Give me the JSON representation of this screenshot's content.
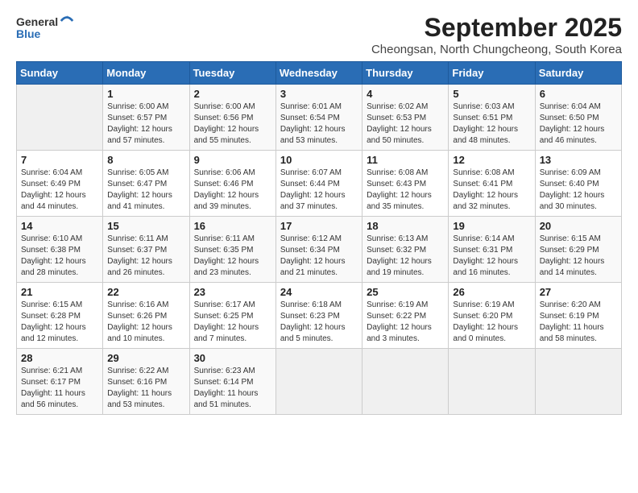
{
  "logo": {
    "general": "General",
    "blue": "Blue"
  },
  "title": "September 2025",
  "subtitle": "Cheongsan, North Chungcheong, South Korea",
  "headers": [
    "Sunday",
    "Monday",
    "Tuesday",
    "Wednesday",
    "Thursday",
    "Friday",
    "Saturday"
  ],
  "weeks": [
    [
      {
        "day": "",
        "info": ""
      },
      {
        "day": "1",
        "info": "Sunrise: 6:00 AM\nSunset: 6:57 PM\nDaylight: 12 hours\nand 57 minutes."
      },
      {
        "day": "2",
        "info": "Sunrise: 6:00 AM\nSunset: 6:56 PM\nDaylight: 12 hours\nand 55 minutes."
      },
      {
        "day": "3",
        "info": "Sunrise: 6:01 AM\nSunset: 6:54 PM\nDaylight: 12 hours\nand 53 minutes."
      },
      {
        "day": "4",
        "info": "Sunrise: 6:02 AM\nSunset: 6:53 PM\nDaylight: 12 hours\nand 50 minutes."
      },
      {
        "day": "5",
        "info": "Sunrise: 6:03 AM\nSunset: 6:51 PM\nDaylight: 12 hours\nand 48 minutes."
      },
      {
        "day": "6",
        "info": "Sunrise: 6:04 AM\nSunset: 6:50 PM\nDaylight: 12 hours\nand 46 minutes."
      }
    ],
    [
      {
        "day": "7",
        "info": "Sunrise: 6:04 AM\nSunset: 6:49 PM\nDaylight: 12 hours\nand 44 minutes."
      },
      {
        "day": "8",
        "info": "Sunrise: 6:05 AM\nSunset: 6:47 PM\nDaylight: 12 hours\nand 41 minutes."
      },
      {
        "day": "9",
        "info": "Sunrise: 6:06 AM\nSunset: 6:46 PM\nDaylight: 12 hours\nand 39 minutes."
      },
      {
        "day": "10",
        "info": "Sunrise: 6:07 AM\nSunset: 6:44 PM\nDaylight: 12 hours\nand 37 minutes."
      },
      {
        "day": "11",
        "info": "Sunrise: 6:08 AM\nSunset: 6:43 PM\nDaylight: 12 hours\nand 35 minutes."
      },
      {
        "day": "12",
        "info": "Sunrise: 6:08 AM\nSunset: 6:41 PM\nDaylight: 12 hours\nand 32 minutes."
      },
      {
        "day": "13",
        "info": "Sunrise: 6:09 AM\nSunset: 6:40 PM\nDaylight: 12 hours\nand 30 minutes."
      }
    ],
    [
      {
        "day": "14",
        "info": "Sunrise: 6:10 AM\nSunset: 6:38 PM\nDaylight: 12 hours\nand 28 minutes."
      },
      {
        "day": "15",
        "info": "Sunrise: 6:11 AM\nSunset: 6:37 PM\nDaylight: 12 hours\nand 26 minutes."
      },
      {
        "day": "16",
        "info": "Sunrise: 6:11 AM\nSunset: 6:35 PM\nDaylight: 12 hours\nand 23 minutes."
      },
      {
        "day": "17",
        "info": "Sunrise: 6:12 AM\nSunset: 6:34 PM\nDaylight: 12 hours\nand 21 minutes."
      },
      {
        "day": "18",
        "info": "Sunrise: 6:13 AM\nSunset: 6:32 PM\nDaylight: 12 hours\nand 19 minutes."
      },
      {
        "day": "19",
        "info": "Sunrise: 6:14 AM\nSunset: 6:31 PM\nDaylight: 12 hours\nand 16 minutes."
      },
      {
        "day": "20",
        "info": "Sunrise: 6:15 AM\nSunset: 6:29 PM\nDaylight: 12 hours\nand 14 minutes."
      }
    ],
    [
      {
        "day": "21",
        "info": "Sunrise: 6:15 AM\nSunset: 6:28 PM\nDaylight: 12 hours\nand 12 minutes."
      },
      {
        "day": "22",
        "info": "Sunrise: 6:16 AM\nSunset: 6:26 PM\nDaylight: 12 hours\nand 10 minutes."
      },
      {
        "day": "23",
        "info": "Sunrise: 6:17 AM\nSunset: 6:25 PM\nDaylight: 12 hours\nand 7 minutes."
      },
      {
        "day": "24",
        "info": "Sunrise: 6:18 AM\nSunset: 6:23 PM\nDaylight: 12 hours\nand 5 minutes."
      },
      {
        "day": "25",
        "info": "Sunrise: 6:19 AM\nSunset: 6:22 PM\nDaylight: 12 hours\nand 3 minutes."
      },
      {
        "day": "26",
        "info": "Sunrise: 6:19 AM\nSunset: 6:20 PM\nDaylight: 12 hours\nand 0 minutes."
      },
      {
        "day": "27",
        "info": "Sunrise: 6:20 AM\nSunset: 6:19 PM\nDaylight: 11 hours\nand 58 minutes."
      }
    ],
    [
      {
        "day": "28",
        "info": "Sunrise: 6:21 AM\nSunset: 6:17 PM\nDaylight: 11 hours\nand 56 minutes."
      },
      {
        "day": "29",
        "info": "Sunrise: 6:22 AM\nSunset: 6:16 PM\nDaylight: 11 hours\nand 53 minutes."
      },
      {
        "day": "30",
        "info": "Sunrise: 6:23 AM\nSunset: 6:14 PM\nDaylight: 11 hours\nand 51 minutes."
      },
      {
        "day": "",
        "info": ""
      },
      {
        "day": "",
        "info": ""
      },
      {
        "day": "",
        "info": ""
      },
      {
        "day": "",
        "info": ""
      }
    ]
  ]
}
